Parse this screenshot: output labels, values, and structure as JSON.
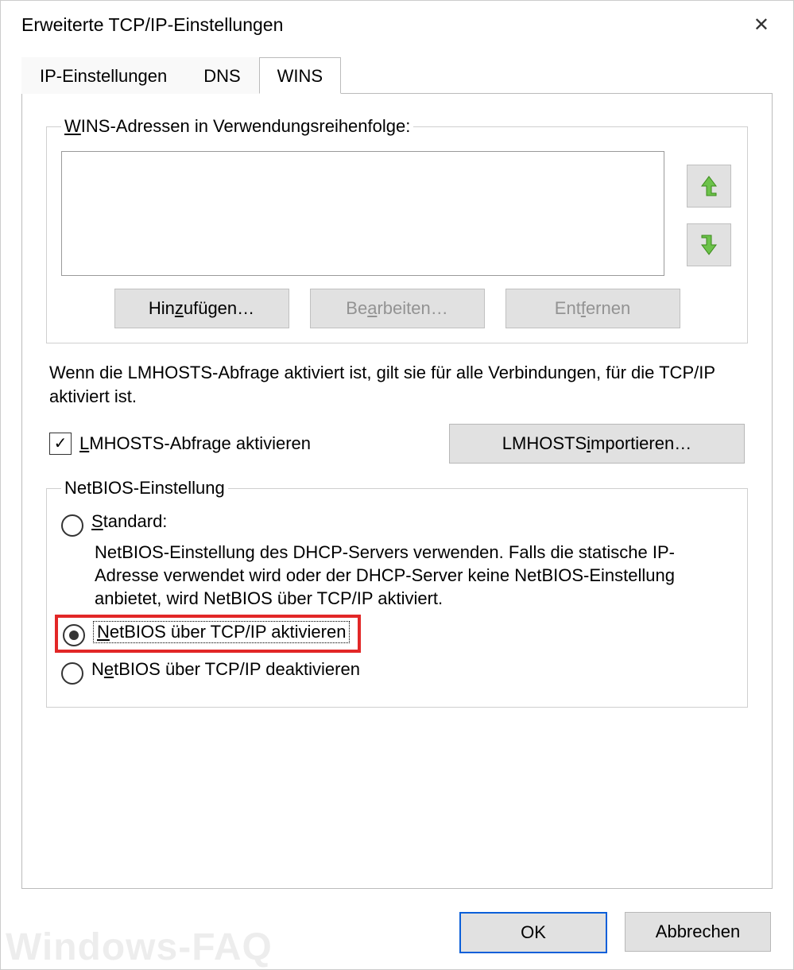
{
  "window": {
    "title": "Erweiterte TCP/IP-Einstellungen",
    "close_glyph": "✕"
  },
  "tabs": {
    "ip": "IP-Einstellungen",
    "dns": "DNS",
    "wins": "WINS",
    "active": "wins"
  },
  "wins_group": {
    "legend_pre": "",
    "legend_u": "W",
    "legend_rest": "INS-Adressen in Verwendungsreihenfolge:",
    "add_pre": "Hin",
    "add_u": "z",
    "add_rest": "ufügen…",
    "edit_pre": "Be",
    "edit_u": "a",
    "edit_rest": "rbeiten…",
    "remove_pre": "Ent",
    "remove_u": "f",
    "remove_rest": "ernen"
  },
  "lmhosts": {
    "desc": "Wenn die LMHOSTS-Abfrage aktiviert ist, gilt sie für alle Verbindungen, für die TCP/IP aktiviert ist.",
    "check_u": "L",
    "check_rest": "MHOSTS-Abfrage aktivieren",
    "checked": true,
    "import_pre": "LMHOSTS ",
    "import_u": "i",
    "import_rest": "mportieren…"
  },
  "netbios": {
    "legend": "NetBIOS-Einstellung",
    "opt_standard_u": "S",
    "opt_standard_rest": "tandard:",
    "standard_desc": "NetBIOS-Einstellung des DHCP-Servers verwenden. Falls die statische IP-Adresse verwendet wird oder der DHCP-Server keine NetBIOS-Einstellung anbietet, wird NetBIOS über TCP/IP aktiviert.",
    "opt_enable_u": "N",
    "opt_enable_rest": "etBIOS über TCP/IP aktivieren",
    "opt_disable_pre": "N",
    "opt_disable_u": "e",
    "opt_disable_rest": "tBIOS über TCP/IP deaktivieren",
    "selected": "enable"
  },
  "dialog": {
    "ok": "OK",
    "cancel": "Abbrechen"
  },
  "watermark": "Windows-FAQ"
}
